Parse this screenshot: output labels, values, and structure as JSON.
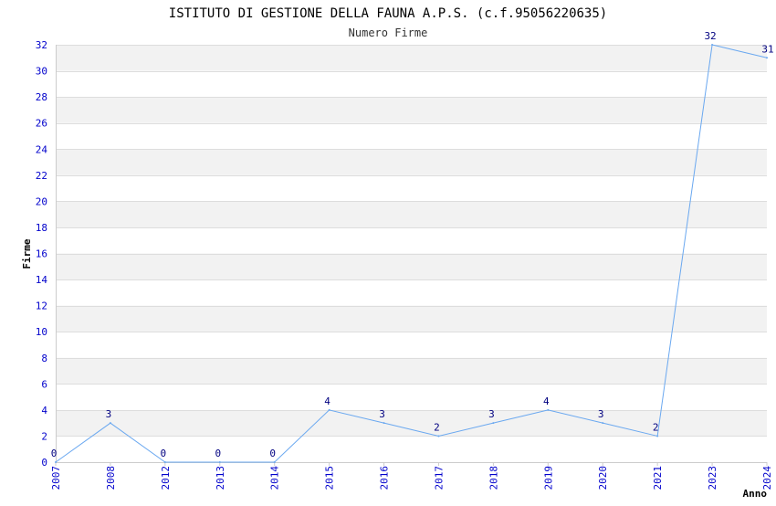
{
  "chart_data": {
    "type": "line",
    "title": "ISTITUTO DI GESTIONE DELLA FAUNA A.P.S. (c.f.95056220635)",
    "subtitle": "Numero Firme",
    "xlabel": "Anno",
    "ylabel": "Firme",
    "categories": [
      "2007",
      "2008",
      "2012",
      "2013",
      "2014",
      "2015",
      "2016",
      "2017",
      "2018",
      "2019",
      "2020",
      "2021",
      "2023",
      "2024"
    ],
    "series": [
      {
        "values": [
          0,
          3,
          0,
          0,
          0,
          4,
          3,
          2,
          3,
          4,
          3,
          2,
          32,
          31
        ]
      }
    ],
    "ylim": [
      0,
      32
    ],
    "yticks": [
      0,
      2,
      4,
      6,
      8,
      10,
      12,
      14,
      16,
      18,
      20,
      22,
      24,
      26,
      28,
      30,
      32
    ],
    "grid": true,
    "colors": {
      "line": "#6aa8f0",
      "tick_label": "#0000cc",
      "data_label": "#000080",
      "band": "#f2f2f2",
      "gridline": "#dddddd",
      "axis": "#cccccc",
      "title": "#000000",
      "subtitle": "#333333"
    }
  }
}
